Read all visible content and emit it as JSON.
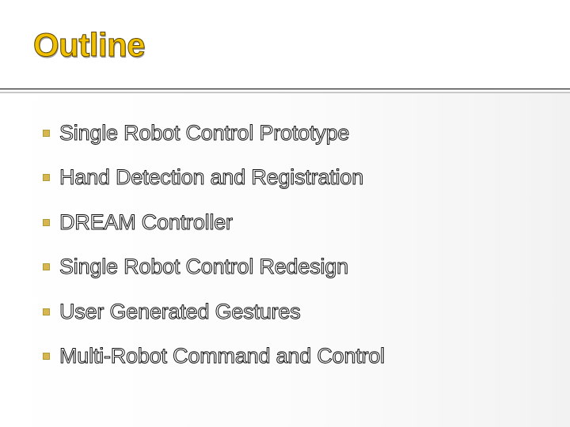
{
  "slide": {
    "title": "Outline",
    "bullets": [
      "Single Robot Control Prototype",
      "Hand Detection and Registration",
      "DREAM Controller",
      "Single Robot Control Redesign",
      "User Generated Gestures",
      "Multi-Robot Command and Control"
    ]
  },
  "colors": {
    "title_fill": "#f0c000",
    "bullet_marker": "#d6b64e",
    "bullet_text_fill": "#ffffff",
    "bullet_text_outline": "#111111",
    "divider": "#000000"
  }
}
